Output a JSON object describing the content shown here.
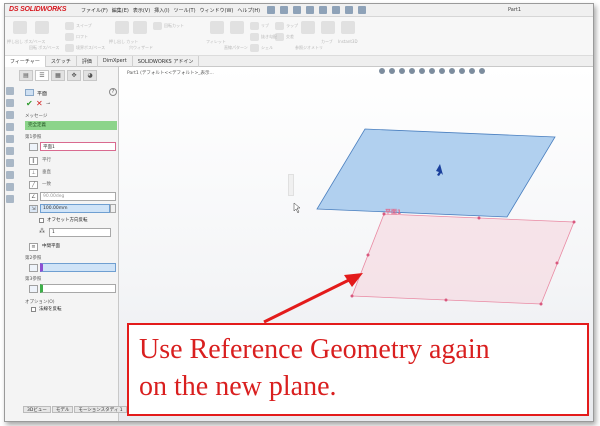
{
  "app": {
    "logo": "DS SOLIDWORKS",
    "menu": [
      "ファイル(F)",
      "編集(E)",
      "表示(V)",
      "挿入(I)",
      "ツール(T)",
      "ウィンドウ(W)",
      "ヘルプ(H)"
    ],
    "document_title": "Part1"
  },
  "ribbon": {
    "labels": [
      "押し出し ボス/ベース",
      "回転 ボス/ベース",
      "スイープ",
      "ロフト",
      "境界ボス/ベース",
      "押し出し カット",
      "穴ウィザード",
      "回転カット",
      "フィレット",
      "直線パターン",
      "リブ",
      "抜き勾配",
      "シェル",
      "ラップ",
      "交差",
      "参照ジオメトリ",
      "カーブ",
      "Instant3D"
    ]
  },
  "command_tabs": [
    "フィーチャー",
    "スケッチ",
    "評価",
    "DimXpert",
    "SOLIDWORKS アドイン"
  ],
  "panel": {
    "title": "平面",
    "message_heading": "メッセージ",
    "message_status": "完全定義",
    "first_ref": {
      "heading": "第1参照",
      "value": "平面1",
      "options": [
        "平行",
        "垂直",
        "一致"
      ],
      "angle": "90.00deg",
      "distance": "100.00mm",
      "flip_label": "オフセット方向反転",
      "count": "1",
      "mid_plane": "中間平面"
    },
    "second_ref": {
      "heading": "第2参照"
    },
    "third_ref": {
      "heading": "第3参照"
    },
    "options": {
      "heading": "オプション(O)",
      "reverse": "法線を反転"
    }
  },
  "viewport": {
    "tree_label": "Part1 (デフォルト<<デフォルト>_表示...",
    "plane_label": "平面1"
  },
  "callout": {
    "text": "Use Reference Geometry again\non the new plane."
  },
  "bottom_tabs": [
    "3Dビュー",
    "モデル",
    "モーションスタディ 1"
  ],
  "colors": {
    "accent_red": "#e31b1b",
    "plane_blue": "#a8cbed",
    "plane_preview": "#e98aa3",
    "status_green": "#8cd48a"
  }
}
